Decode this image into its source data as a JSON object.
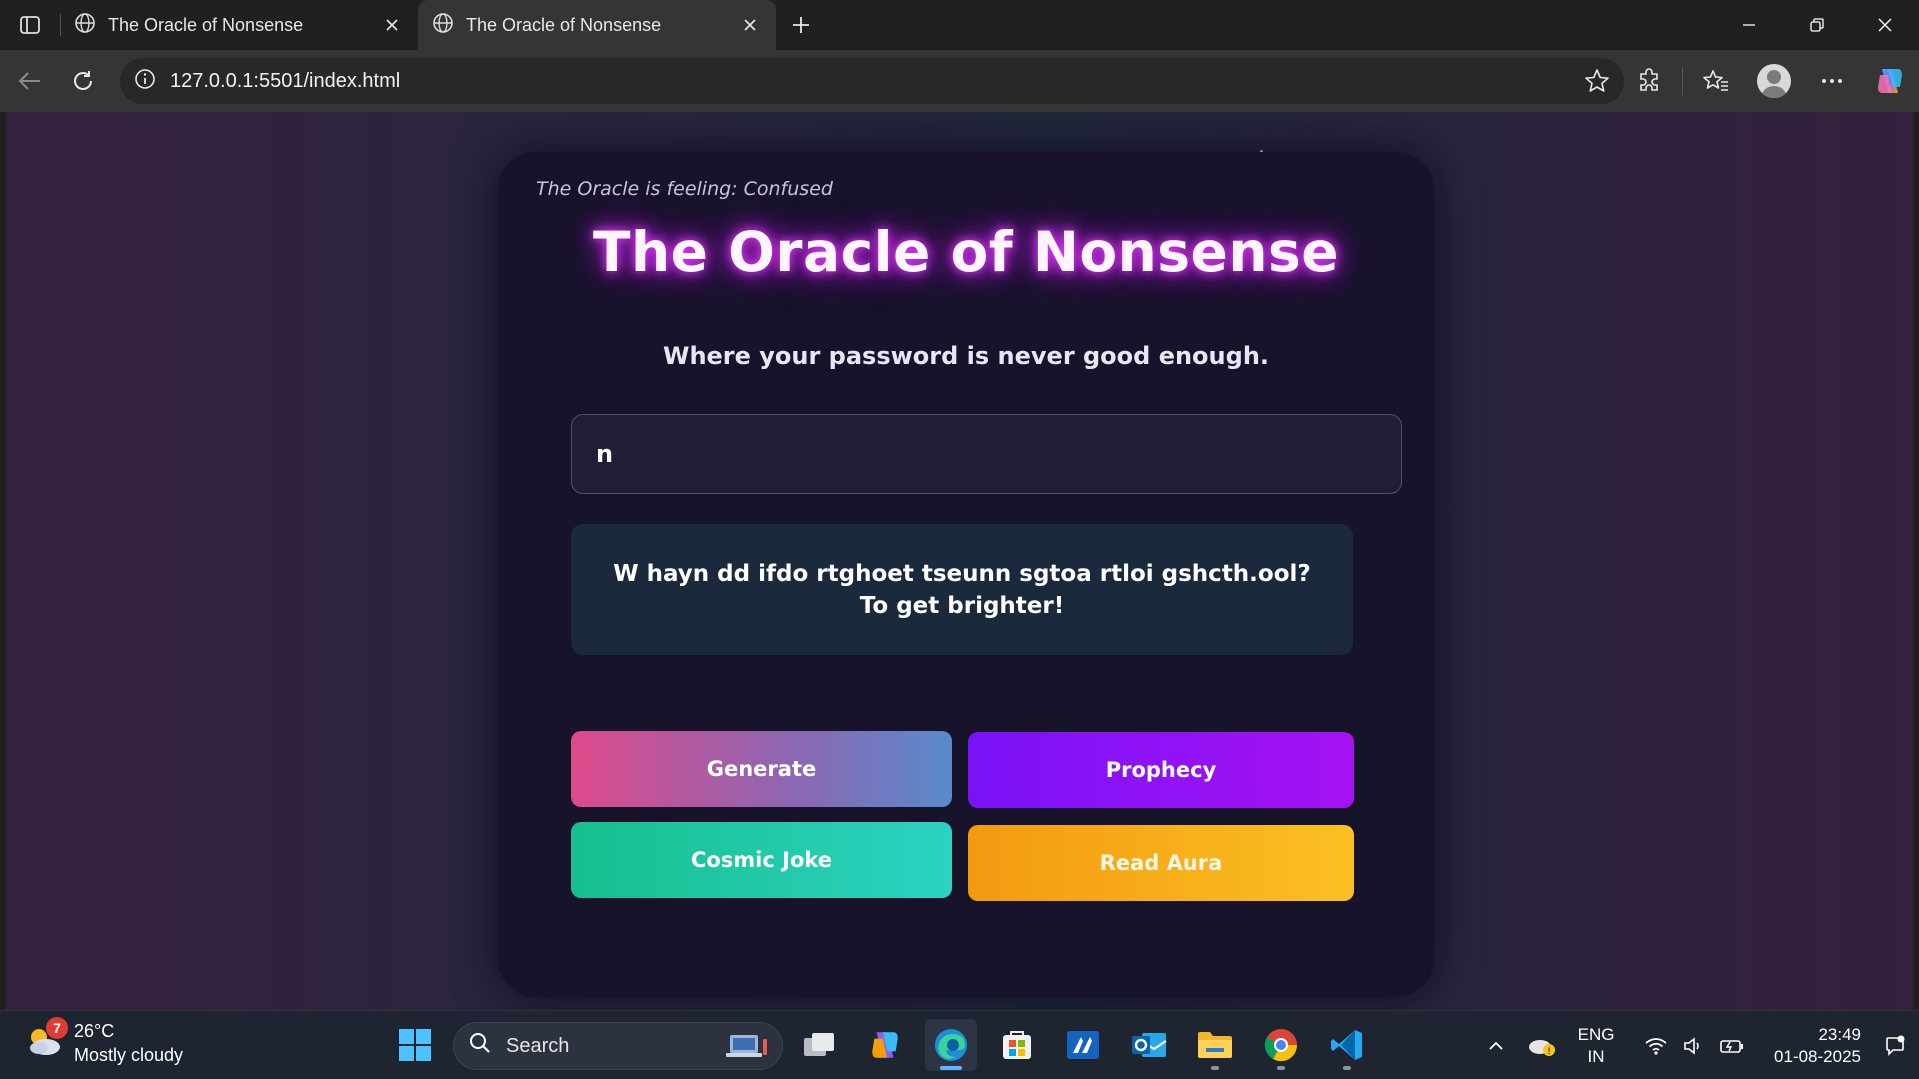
{
  "browser": {
    "tabs": [
      {
        "title": "The Oracle of Nonsense",
        "active": false
      },
      {
        "title": "The Oracle of Nonsense",
        "active": true
      }
    ],
    "url": "127.0.0.1:5501/index.html"
  },
  "page": {
    "mood": "The Oracle is feeling: Confused",
    "title": "The Oracle of Nonsense",
    "subtitle": "Where your password is never good enough.",
    "password_value": "n",
    "message": "W hayn dd ifdo rtghoet tseunn sgtoa rtloi gshcth.ool? To get brighter!",
    "buttons": {
      "generate": "Generate",
      "prophecy": "Prophecy",
      "cosmic_joke": "Cosmic Joke",
      "read_aura": "Read Aura"
    },
    "colors": {
      "card": "#17132a",
      "title_glow": "#e040fb",
      "prophecy": "#8a12f5",
      "cosmic_joke": "#1fc9a8",
      "read_aura": "#f6ab18"
    }
  },
  "taskbar": {
    "weather": {
      "temp": "26°C",
      "condition": "Mostly cloudy",
      "badge": "7"
    },
    "search_placeholder": "Search",
    "lang_line1": "ENG",
    "lang_line2": "IN",
    "time": "23:49",
    "date": "01-08-2025"
  }
}
